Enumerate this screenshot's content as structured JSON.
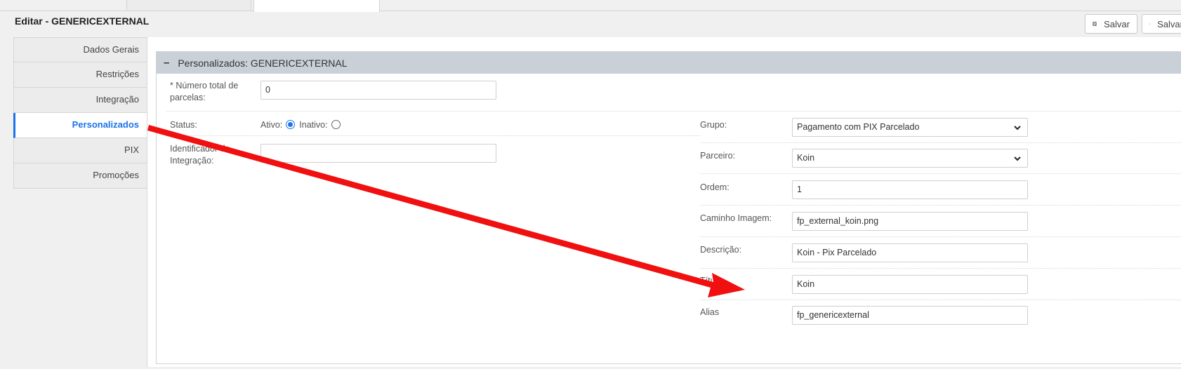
{
  "header": {
    "title": "Editar - GENERICEXTERNAL",
    "save_buttons": [
      "Salvar",
      "Salvar"
    ]
  },
  "sidebar": {
    "items": [
      {
        "label": "Dados Gerais"
      },
      {
        "label": "Restrições"
      },
      {
        "label": "Integração"
      },
      {
        "label": "Personalizados",
        "active": true
      },
      {
        "label": "PIX"
      },
      {
        "label": "Promoções"
      }
    ]
  },
  "section": {
    "collapse_symbol": "–",
    "title": "Personalizados: GENERICEXTERNAL"
  },
  "left_form": {
    "parcelas_label": "* Número total de parcelas:",
    "parcelas_value": "0",
    "status_label": "Status:",
    "status_ativo": "Ativo:",
    "status_inativo": "Inativo:",
    "status_selected": "Ativo",
    "identificador_label": "Identificador de Integração:",
    "identificador_value": ""
  },
  "right_form": {
    "grupo_label": "Grupo:",
    "grupo_value": "Pagamento com PIX Parcelado",
    "parceiro_label": "Parceiro:",
    "parceiro_value": "Koin",
    "ordem_label": "Ordem:",
    "ordem_value": "1",
    "caminho_label": "Caminho Imagem:",
    "caminho_value": "fp_external_koin.png",
    "descricao_label": "Descrição:",
    "descricao_value": "Koin - Pix Parcelado",
    "titulo_label": "Título",
    "titulo_value": "Koin",
    "alias_label": "Alias",
    "alias_value": "fp_genericexternal"
  },
  "annotation": {
    "color": "#f01010"
  }
}
